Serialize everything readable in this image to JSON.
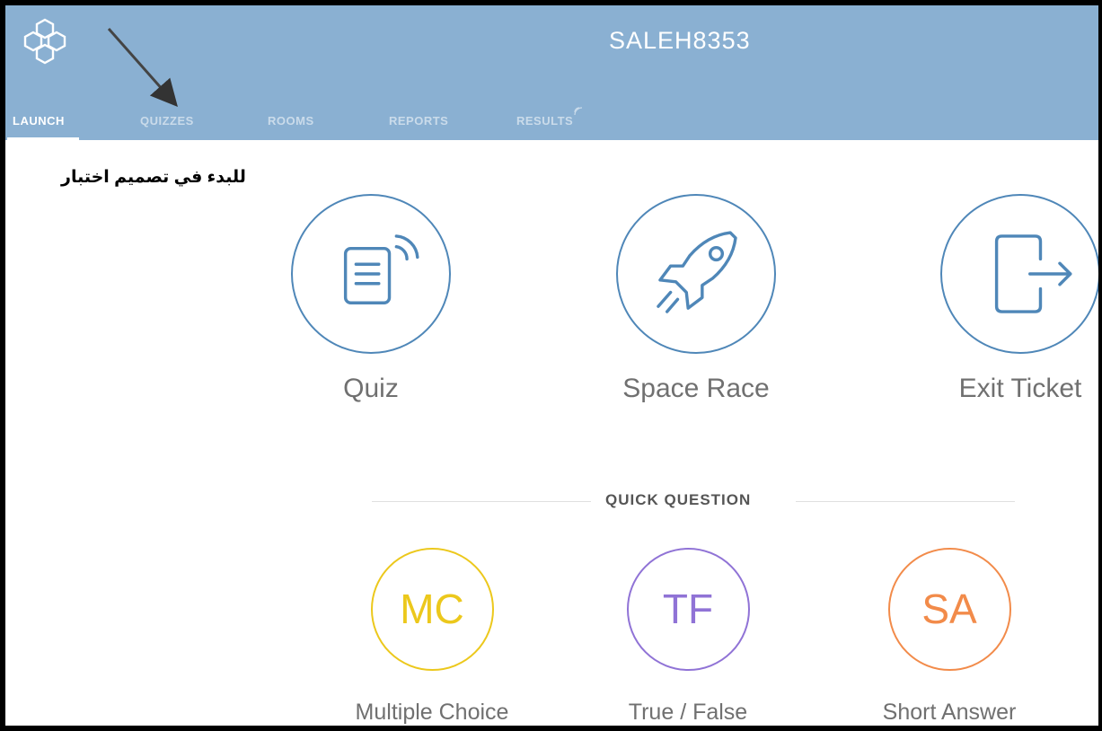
{
  "header": {
    "room_name": "SALEH8353",
    "tabs": [
      {
        "label": "LAUNCH",
        "active": true
      },
      {
        "label": "QUIZZES",
        "active": false
      },
      {
        "label": "ROOMS",
        "active": false
      },
      {
        "label": "REPORTS",
        "active": false
      },
      {
        "label": "RESULTS",
        "active": false
      }
    ],
    "background_color": "#8ab0d2"
  },
  "annotation": {
    "text": "للبدء في تصميم اختبار"
  },
  "launch": {
    "items": [
      {
        "label": "Quiz",
        "icon": "quiz-icon"
      },
      {
        "label": "Space Race",
        "icon": "rocket-icon"
      },
      {
        "label": "Exit Ticket",
        "icon": "exit-ticket-icon"
      }
    ],
    "accent_color": "#4f87b8"
  },
  "quick_question": {
    "title": "QUICK QUESTION",
    "items": [
      {
        "abbr": "MC",
        "label": "Multiple Choice",
        "color": "#ecc81c"
      },
      {
        "abbr": "TF",
        "label": "True / False",
        "color": "#9073d6"
      },
      {
        "abbr": "SA",
        "label": "Short Answer",
        "color": "#f28b4a"
      }
    ]
  }
}
